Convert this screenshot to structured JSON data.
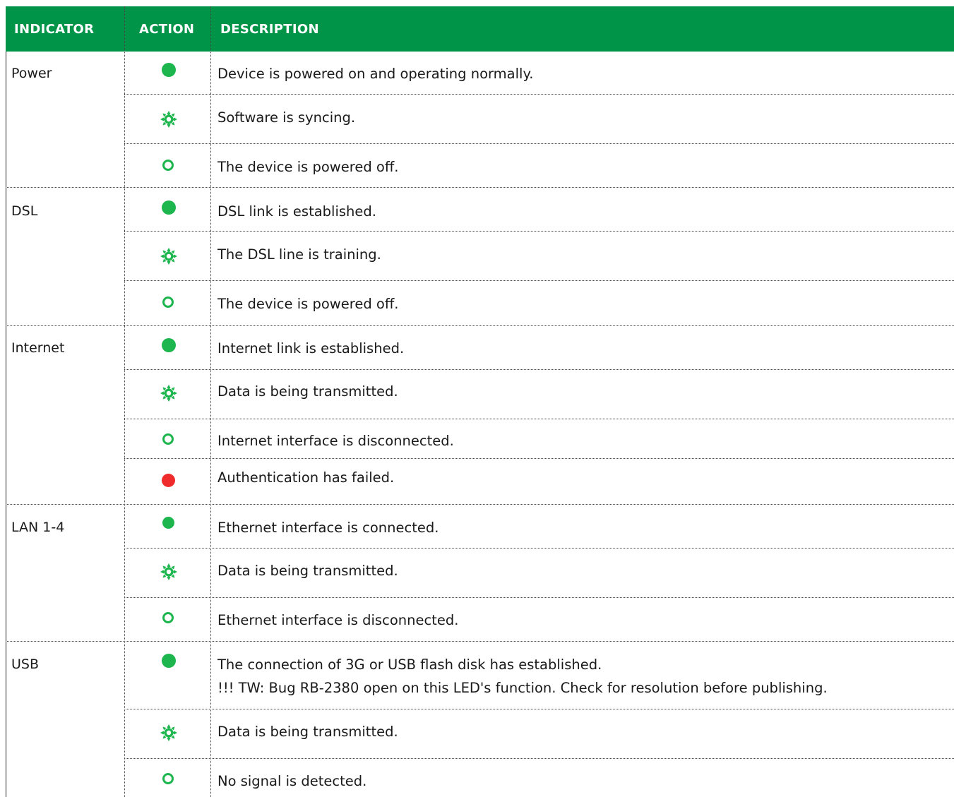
{
  "header": {
    "indicator": "INDICATOR",
    "action": "ACTION",
    "description": "DESCRIPTION"
  },
  "colors": {
    "header_bg": "#009448",
    "led_green": "#1db64e",
    "led_red": "#ef2b2b"
  },
  "icons": {
    "on": "solid-green-dot-icon",
    "blinking": "blinking-green-led-icon",
    "off": "hollow-green-circle-icon",
    "error": "solid-red-dot-icon"
  },
  "rows": [
    {
      "indicator": "Power",
      "action": "on",
      "description": "Device is powered on and operating normally."
    },
    {
      "indicator": "",
      "action": "blinking",
      "description": "Software is syncing."
    },
    {
      "indicator": "",
      "action": "off",
      "description": "The device is powered off."
    },
    {
      "indicator": "DSL",
      "action": "on",
      "description": "DSL link is established."
    },
    {
      "indicator": "",
      "action": "blinking",
      "description": "The DSL line is training."
    },
    {
      "indicator": "",
      "action": "off",
      "description": "The device is powered off."
    },
    {
      "indicator": "Internet",
      "action": "on",
      "description": "Internet link is established."
    },
    {
      "indicator": "",
      "action": "blinking",
      "description": "Data is being transmitted."
    },
    {
      "indicator": "",
      "action": "off",
      "description": "Internet interface is disconnected."
    },
    {
      "indicator": "",
      "action": "error",
      "description": "Authentication has failed."
    },
    {
      "indicator": "LAN 1-4",
      "action": "on",
      "description": "Ethernet interface is connected."
    },
    {
      "indicator": "",
      "action": "blinking",
      "description": "Data is being transmitted."
    },
    {
      "indicator": "",
      "action": "off",
      "description": "Ethernet interface is disconnected."
    },
    {
      "indicator": "USB",
      "action": "on",
      "description": "The connection of 3G or USB flash disk has established.",
      "note": "!!! TW: Bug RB-2380 open on this LED's function. Check for resolution before publishing."
    },
    {
      "indicator": "",
      "action": "blinking",
      "description": "Data is being transmitted."
    },
    {
      "indicator": "",
      "action": "off",
      "description": "No signal is detected."
    }
  ]
}
